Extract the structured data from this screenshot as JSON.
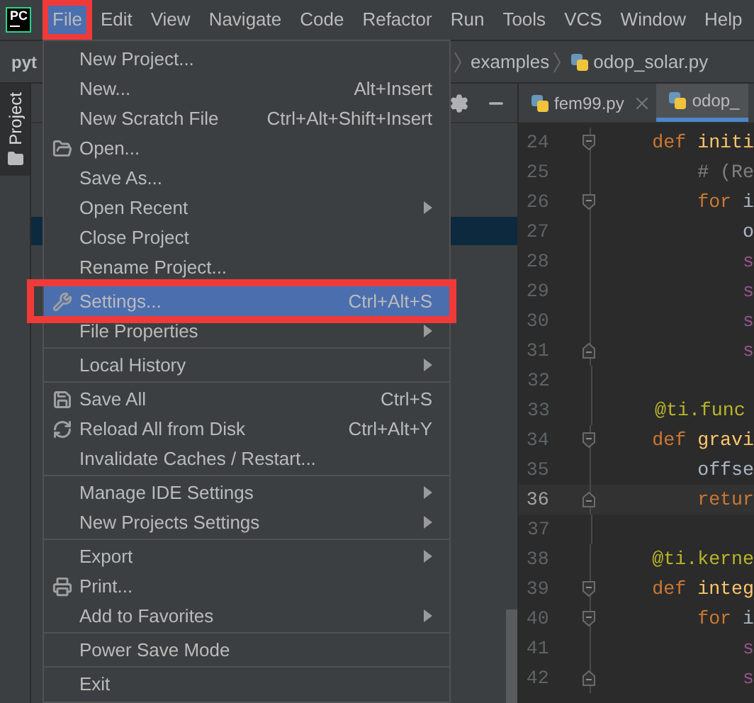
{
  "logo": "PC",
  "menu_bar": [
    {
      "label": "File",
      "selected": true,
      "outlined": true
    },
    {
      "label": "Edit",
      "selected": false,
      "outlined": false
    },
    {
      "label": "View",
      "selected": false,
      "outlined": false
    },
    {
      "label": "Navigate",
      "selected": false,
      "outlined": false
    },
    {
      "label": "Code",
      "selected": false,
      "outlined": false
    },
    {
      "label": "Refactor",
      "selected": false,
      "outlined": false
    },
    {
      "label": "Run",
      "selected": false,
      "outlined": false
    },
    {
      "label": "Tools",
      "selected": false,
      "outlined": false
    },
    {
      "label": "VCS",
      "selected": false,
      "outlined": false
    },
    {
      "label": "Window",
      "selected": false,
      "outlined": false
    },
    {
      "label": "Help",
      "selected": false,
      "outlined": false
    }
  ],
  "project_name": "pyt",
  "breadcrumbs": [
    {
      "label": "examples"
    },
    {
      "label": "odop_solar.py"
    }
  ],
  "side_tab": {
    "label": "Project",
    "selected": true
  },
  "editor_tabs": [
    {
      "label": "fem99.py",
      "selected": false,
      "closable": true
    },
    {
      "label": "odop_",
      "selected": true,
      "closable": false
    }
  ],
  "file_menu": [
    {
      "kind": "item",
      "label": "New Project...",
      "selected": false,
      "outlined": false,
      "submenu": false
    },
    {
      "kind": "item",
      "label": "New...",
      "shortcut": "Alt+Insert",
      "selected": false,
      "outlined": false,
      "submenu": false
    },
    {
      "kind": "item",
      "label": "New Scratch File",
      "shortcut": "Ctrl+Alt+Shift+Insert",
      "selected": false,
      "outlined": false,
      "submenu": false
    },
    {
      "kind": "item",
      "label": "Open...",
      "selected": false,
      "outlined": false,
      "submenu": false
    },
    {
      "kind": "item",
      "label": "Save As...",
      "selected": false,
      "outlined": false,
      "submenu": false
    },
    {
      "kind": "item",
      "label": "Open Recent",
      "selected": false,
      "outlined": false,
      "submenu": true
    },
    {
      "kind": "item",
      "label": "Close Project",
      "selected": false,
      "outlined": false,
      "submenu": false
    },
    {
      "kind": "item",
      "label": "Rename Project...",
      "selected": false,
      "outlined": false,
      "submenu": false
    },
    {
      "kind": "separator"
    },
    {
      "kind": "item",
      "label": "Settings...",
      "shortcut": "Ctrl+Alt+S",
      "selected": true,
      "outlined": true,
      "submenu": false
    },
    {
      "kind": "item",
      "label": "File Properties",
      "selected": false,
      "outlined": false,
      "submenu": true
    },
    {
      "kind": "separator"
    },
    {
      "kind": "item",
      "label": "Local History",
      "selected": false,
      "outlined": false,
      "submenu": true
    },
    {
      "kind": "separator"
    },
    {
      "kind": "item",
      "label": "Save All",
      "shortcut": "Ctrl+S",
      "selected": false,
      "outlined": false,
      "submenu": false
    },
    {
      "kind": "item",
      "label": "Reload All from Disk",
      "shortcut": "Ctrl+Alt+Y",
      "selected": false,
      "outlined": false,
      "submenu": false
    },
    {
      "kind": "item",
      "label": "Invalidate Caches / Restart...",
      "selected": false,
      "outlined": false,
      "submenu": false
    },
    {
      "kind": "separator"
    },
    {
      "kind": "item",
      "label": "Manage IDE Settings",
      "selected": false,
      "outlined": false,
      "submenu": true
    },
    {
      "kind": "item",
      "label": "New Projects Settings",
      "selected": false,
      "outlined": false,
      "submenu": true
    },
    {
      "kind": "separator"
    },
    {
      "kind": "item",
      "label": "Export",
      "selected": false,
      "outlined": false,
      "submenu": true
    },
    {
      "kind": "item",
      "label": "Print...",
      "selected": false,
      "outlined": false,
      "submenu": false
    },
    {
      "kind": "item",
      "label": "Add to Favorites",
      "selected": false,
      "outlined": false,
      "submenu": true
    },
    {
      "kind": "separator"
    },
    {
      "kind": "item",
      "label": "Power Save Mode",
      "selected": false,
      "outlined": false,
      "submenu": false
    },
    {
      "kind": "separator"
    },
    {
      "kind": "item",
      "label": "Exit",
      "selected": false,
      "outlined": false,
      "submenu": false
    }
  ],
  "code_lines": [
    {
      "number": "24",
      "current": false,
      "fold_start": true,
      "fold_end": false,
      "tokens": [
        {
          "kind": "keyword",
          "text": "def "
        },
        {
          "kind": "name",
          "text": "initi"
        }
      ]
    },
    {
      "number": "25",
      "current": false,
      "fold_start": false,
      "fold_end": false,
      "tokens": [
        {
          "kind": "comment",
          "text": "    # (Re"
        }
      ]
    },
    {
      "number": "26",
      "current": false,
      "fold_start": true,
      "fold_end": false,
      "tokens": [
        {
          "kind": "keyword",
          "text": "    for "
        },
        {
          "kind": "plain",
          "text": "i"
        }
      ]
    },
    {
      "number": "27",
      "current": false,
      "fold_start": false,
      "fold_end": false,
      "tokens": [
        {
          "kind": "plain",
          "text": "        o"
        }
      ]
    },
    {
      "number": "28",
      "current": false,
      "fold_start": false,
      "fold_end": false,
      "tokens": [
        {
          "kind": "self",
          "text": "        s"
        }
      ]
    },
    {
      "number": "29",
      "current": false,
      "fold_start": false,
      "fold_end": false,
      "tokens": [
        {
          "kind": "self",
          "text": "        s"
        }
      ]
    },
    {
      "number": "30",
      "current": false,
      "fold_start": false,
      "fold_end": false,
      "tokens": [
        {
          "kind": "self",
          "text": "        s"
        }
      ]
    },
    {
      "number": "31",
      "current": false,
      "fold_start": false,
      "fold_end": true,
      "tokens": [
        {
          "kind": "self",
          "text": "        s"
        }
      ]
    },
    {
      "number": "32",
      "current": false,
      "fold_start": false,
      "fold_end": false
    },
    {
      "number": "33",
      "current": false,
      "fold_start": false,
      "fold_end": false,
      "tokens": [
        {
          "kind": "decorator",
          "text": "@ti.func"
        }
      ]
    },
    {
      "number": "34",
      "current": false,
      "fold_start": true,
      "fold_end": false,
      "tokens": [
        {
          "kind": "keyword",
          "text": "def "
        },
        {
          "kind": "name",
          "text": "gravi"
        }
      ]
    },
    {
      "number": "35",
      "current": false,
      "fold_start": false,
      "fold_end": false,
      "tokens": [
        {
          "kind": "plain",
          "text": "    offse"
        }
      ]
    },
    {
      "number": "36",
      "current": true,
      "fold_start": false,
      "fold_end": true,
      "tokens": [
        {
          "kind": "keyword",
          "text": "    retur"
        }
      ]
    },
    {
      "number": "37",
      "current": false,
      "fold_start": false,
      "fold_end": false
    },
    {
      "number": "38",
      "current": false,
      "fold_start": false,
      "fold_end": false,
      "tokens": [
        {
          "kind": "decorator",
          "text": "@ti.kerne"
        }
      ]
    },
    {
      "number": "39",
      "current": false,
      "fold_start": true,
      "fold_end": false,
      "tokens": [
        {
          "kind": "keyword",
          "text": "def "
        },
        {
          "kind": "name",
          "text": "integ"
        }
      ]
    },
    {
      "number": "40",
      "current": false,
      "fold_start": true,
      "fold_end": false,
      "tokens": [
        {
          "kind": "keyword",
          "text": "    for "
        },
        {
          "kind": "plain",
          "text": "i"
        }
      ]
    },
    {
      "number": "41",
      "current": false,
      "fold_start": false,
      "fold_end": false,
      "tokens": [
        {
          "kind": "self",
          "text": "        s"
        }
      ]
    },
    {
      "number": "42",
      "current": false,
      "fold_start": false,
      "fold_end": true,
      "tokens": [
        {
          "kind": "self",
          "text": "        s"
        }
      ]
    }
  ]
}
